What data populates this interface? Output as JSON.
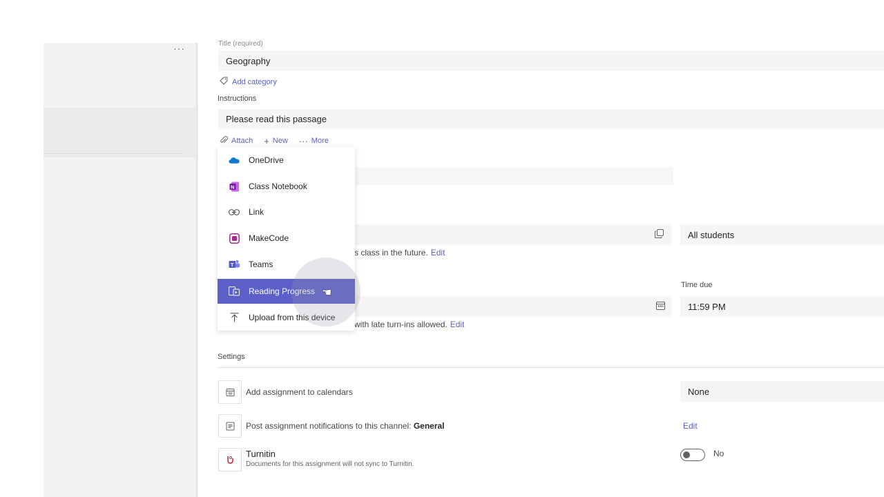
{
  "left_panel": {
    "more": "···"
  },
  "form": {
    "title_label": "Title (required)",
    "title_value": "Geography",
    "add_category": "Add category",
    "instructions_label": "Instructions",
    "instructions_value": "Please read this passage",
    "toolbar": {
      "attach": "Attach",
      "new": "New",
      "more": "More"
    },
    "students_value": "All students",
    "future_text": "s class in the future.",
    "future_edit": "Edit",
    "time_due_label": "Time due",
    "time_due_value": "11:59 PM",
    "late_text": "with late turn-ins allowed.",
    "late_edit": "Edit"
  },
  "settings": {
    "label": "Settings",
    "calendar_text": "Add assignment to calendars",
    "calendar_value": "None",
    "notif_text": "Post assignment notifications to this channel: ",
    "notif_channel": "General",
    "notif_edit": "Edit",
    "turnitin_title": "Turnitin",
    "turnitin_sub": "Documents for this assignment will not sync to Turnitin.",
    "turnitin_toggle": "No"
  },
  "menu": {
    "items": [
      {
        "label": "OneDrive",
        "icon": "onedrive-icon"
      },
      {
        "label": "Class Notebook",
        "icon": "onenote-icon"
      },
      {
        "label": "Link",
        "icon": "link-icon"
      },
      {
        "label": "MakeCode",
        "icon": "makecode-icon"
      },
      {
        "label": "Teams",
        "icon": "teams-icon"
      },
      {
        "label": "Reading Progress",
        "icon": "reading-progress-icon"
      },
      {
        "label": "Upload from this device",
        "icon": "upload-icon"
      }
    ],
    "active": "Reading Progress"
  },
  "colors": {
    "accent": "#5b5fc7",
    "onedrive": "#0f78d4",
    "onenote": "#7719aa",
    "makecode": "#a4288f",
    "teams": "#5059c9"
  }
}
